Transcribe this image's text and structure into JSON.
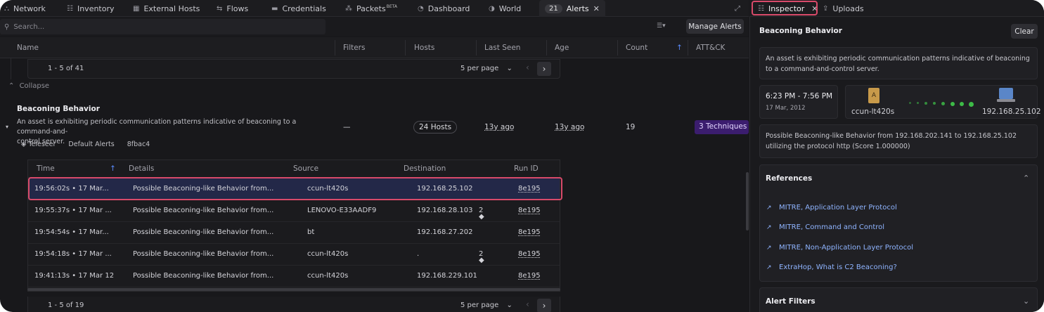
{
  "tabs": {
    "network": "Network",
    "inventory": "Inventory",
    "external_hosts": "External Hosts",
    "flows": "Flows",
    "credentials": "Credentials",
    "packets": "Packets",
    "packets_sup": "BETA",
    "dashboard": "Dashboard",
    "world": "World",
    "alerts_count": "21",
    "alerts": "Alerts",
    "close_glyph": "✕"
  },
  "search": {
    "placeholder": "Search..."
  },
  "toolbar": {
    "manage_alerts": "Manage Alerts",
    "filter_glyph": "☰▾"
  },
  "columns": {
    "name": "Name",
    "filters": "Filters",
    "hosts": "Hosts",
    "last_seen": "Last Seen",
    "age": "Age",
    "count": "Count",
    "attck": "ATT&CK"
  },
  "top_pager": {
    "range": "1 - 5 of 41",
    "per_page": "5 per page"
  },
  "collapse_label": "Collapse",
  "alert": {
    "title": "Beaconing Behavior",
    "description_line1": "An asset is exhibiting periodic communication patterns indicative of beaconing to a command-and-",
    "description_line2": "control server.",
    "filters": "—",
    "hosts": "24 Hosts",
    "last_seen": "13y ago",
    "age": "13y ago",
    "count": "19",
    "techniques": "3 Techniques",
    "source": "Teleseer",
    "ruleset": "Default Alerts",
    "id": "8fbac4"
  },
  "sub_columns": {
    "time": "Time",
    "details": "Details",
    "source": "Source",
    "destination": "Destination",
    "run_id": "Run ID"
  },
  "rows": [
    {
      "time": "19:56:02s • 17 Mar...",
      "details": "Possible Beaconing-like Behavior from...",
      "source": "ccun-lt420s",
      "destination": "192.168.25.102",
      "tag": "",
      "run": "8e195"
    },
    {
      "time": "19:55:37s • 17 Mar ...",
      "details": "Possible Beaconing-like Behavior from...",
      "source": "LENOVO-E33AADF9",
      "destination": "192.168.28.103",
      "tag": "2",
      "run": "8e195"
    },
    {
      "time": "19:54:54s • 17 Mar...",
      "details": "Possible Beaconing-like Behavior from...",
      "source": "bt",
      "destination": "192.168.27.202",
      "tag": "",
      "run": "8e195"
    },
    {
      "time": "19:54:18s • 17 Mar ...",
      "details": "Possible Beaconing-like Behavior from...",
      "source": "ccun-lt420s",
      "destination": ".",
      "tag": "2",
      "run": "8e195"
    },
    {
      "time": "19:41:13s • 17 Mar 12",
      "details": "Possible Beaconing-like Behavior from...",
      "source": "ccun-lt420s",
      "destination": "192.168.229.101",
      "tag": "",
      "run": "8e195"
    }
  ],
  "bottom_pager": {
    "range": "1 - 5 of 19",
    "per_page": "5 per page"
  },
  "inspector": {
    "tab": "Inspector",
    "uploads": "Uploads",
    "title": "Beaconing Behavior",
    "clear": "Clear",
    "description": "An asset is exhibiting periodic communication patterns indicative of beaconing to a command-and-control server.",
    "time_range": "6:23 PM - 7:56 PM",
    "date": "17 Mar, 2012",
    "src_host": "ccun-lt420s",
    "dst_host": "192.168.25.102",
    "summary": "Possible Beaconing-like Behavior from 192.168.202.141 to 192.168.25.102 utilizing the protocol http (Score 1.000000)",
    "references_title": "References",
    "references": [
      "MITRE, Application Layer Protocol",
      "MITRE, Command and Control",
      "MITRE, Non-Application Layer Protocol",
      "ExtraHop, What is C2 Beaconing?"
    ],
    "alert_filters": "Alert Filters"
  },
  "colors": {
    "highlight": "#d94a6a",
    "accent": "#8fb4ff",
    "technique_bg": "#3b1d6e",
    "beacon_dot": "#3dbb47"
  }
}
